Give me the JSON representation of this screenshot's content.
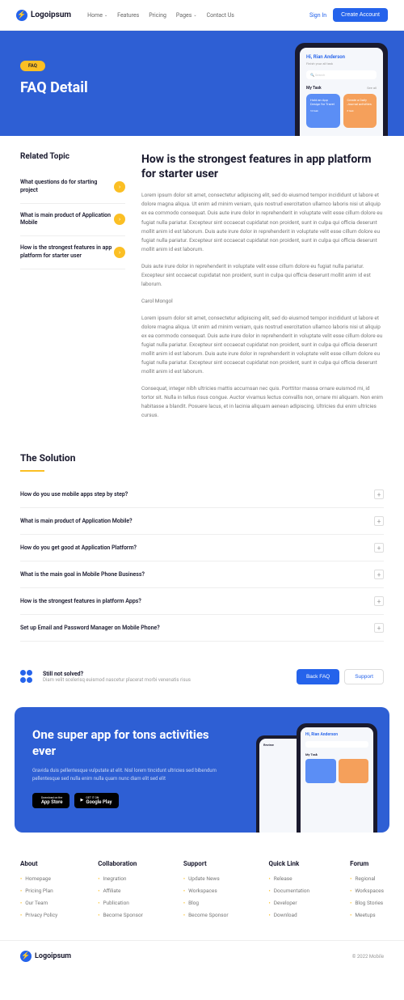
{
  "nav": {
    "brand": "Logoipsum",
    "links": [
      "Home",
      "Features",
      "Pricing",
      "Pages",
      "Contact Us"
    ],
    "sign_in": "Sign In",
    "create": "Create Account"
  },
  "hero": {
    "badge": "FAQ",
    "title": "FAQ Detail",
    "phone": {
      "greeting": "Hi, Rian Anderson",
      "subtitle": "Finish your all task",
      "search": "Search",
      "section": "My Task",
      "see_all": "See all",
      "card1": {
        "title": "Hold an App Design for Travel",
        "count": "10 task"
      },
      "card2": {
        "title": "Create a Daily Journal activities",
        "count": "8 task"
      }
    }
  },
  "sidebar": {
    "title": "Related Topic",
    "items": [
      "What questions do for starting project",
      "What is main product of Application Mobile",
      "How is the strongest features in app platform for starter user"
    ]
  },
  "article": {
    "title": "How is the strongest features in app platform for starter user",
    "p1": "Lorem ipsum dolor sit amet, consectetur adipiscing elit, sed do eiusmod tempor incididunt ut labore et dolore magna aliqua. Ut enim ad minim veniam, quis nostrud exercitation ullamco laboris nisi ut aliquip ex ea commodo consequat. Duis aute irure dolor in reprehenderit in voluptate velit esse cillum dolore eu fugiat nulla pariatur. Excepteur sint occaecat cupidatat non proident, sunt in culpa qui officia deserunt mollit anim id est laborum. Duis aute irure dolor in reprehenderit in voluptate velit esse cillum dolore eu fugiat nulla pariatur. Excepteur sint occaecat cupidatat non proident, sunt in culpa qui officia deserunt mollit anim id est laborum.",
    "p2": "Duis aute irure dolor in reprehenderit in voluptate velit esse cillum dolore eu fugiat nulla pariatur. Excepteur sint occaecat cupidatat non proident, sunt in culpa qui officia deserunt mollit anim id est laborum.",
    "author": "Carol Mongol",
    "p3": "Lorem ipsum dolor sit amet, consectetur adipiscing elit, sed do eiusmod tempor incididunt ut labore et dolore magna aliqua. Ut enim ad minim veniam, quis nostrud exercitation ullamco laboris nisi ut aliquip ex ea commodo consequat. Duis aute irure dolor in reprehenderit in voluptate velit esse cillum dolore eu fugiat nulla pariatur. Excepteur sint occaecat cupidatat non proident, sunt in culpa qui officia deserunt mollit anim id est laborum. Duis aute irure dolor in reprehenderit in voluptate velit esse cillum dolore eu fugiat nulla pariatur. Excepteur sint occaecat cupidatat non proident, sunt in culpa qui officia deserunt mollit anim id est laborum.",
    "p4": "Consequat, integer nibh ultricies mattis accumsan nec quis. Porttitor massa ornare euismod mi, id tortor sit. Nulla in tellus risus congue. Auctor vivamus lectus convallis non, ornare mi aliquam. Non enim habitasse a blandit. Posuere lacus, et in lacinia aliquam aenean adipiscing. Ultricies dui enim ultricies cursus."
  },
  "solution": {
    "title": "The Solution",
    "items": [
      "How do you use mobile apps step by step?",
      "What is main product of Application Mobile?",
      "How do you get good at Application Platform?",
      "What is the main goal in Mobile Phone Business?",
      "How is the strongest features in platform Apps?",
      "Set up Email and Password Manager on Mobile Phone?"
    ]
  },
  "help": {
    "title": "Still not solved?",
    "desc": "Diam velit scelerisq euismod nascetur placerat morbi venenatis risus",
    "back": "Back FAQ",
    "support": "Support"
  },
  "cta": {
    "title": "One super app for tons activities ever",
    "desc": "Gravida duis pellentesque vulputate at elit. Nisl lorem tincidunt ultricies sed bibendum pellentesque sed nulla enim nulla quam nunc diam elit sed elit",
    "appstore": {
      "small": "Download on the",
      "big": "App Store"
    },
    "playstore": {
      "small": "GET IT ON",
      "big": "Google Play"
    },
    "phone": {
      "greeting": "Hi, Rian Anderson",
      "review": "Review",
      "section": "My Task"
    }
  },
  "footer": {
    "cols": [
      {
        "title": "About",
        "links": [
          "Homepage",
          "Pricing Plan",
          "Our Team",
          "Privacy Policy"
        ]
      },
      {
        "title": "Collaboration",
        "links": [
          "Inegration",
          "Affiliate",
          "Publication",
          "Become Sponsor"
        ]
      },
      {
        "title": "Support",
        "links": [
          "Update News",
          "Workspaces",
          "Blog",
          "Become Sponsor"
        ]
      },
      {
        "title": "Quick Link",
        "links": [
          "Release",
          "Documentation",
          "Developer",
          "Download"
        ]
      },
      {
        "title": "Forum",
        "links": [
          "Regional",
          "Workspaces",
          "Blog Stories",
          "Meetups"
        ]
      }
    ],
    "brand": "Logoipsum",
    "copyright": "© 2022 Mobile"
  }
}
